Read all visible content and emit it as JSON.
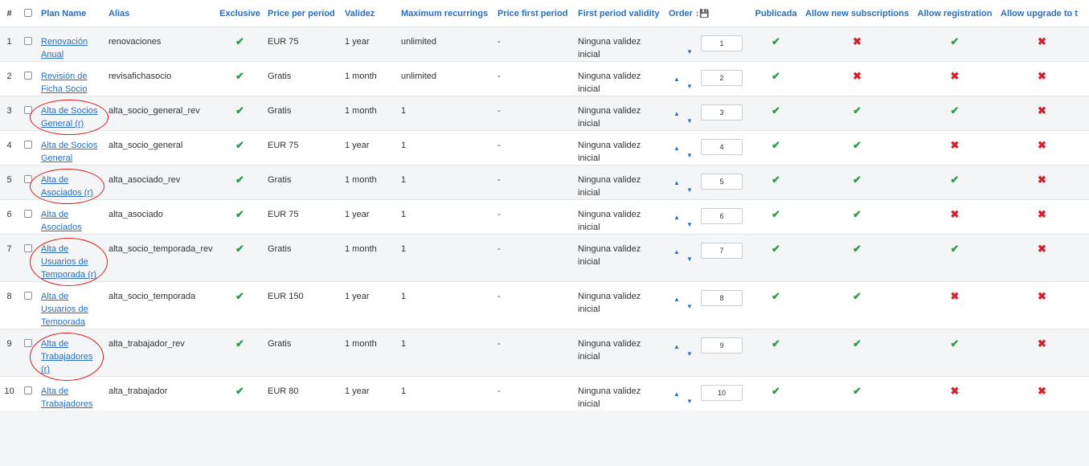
{
  "headers": {
    "num": "#",
    "plan_name": "Plan Name",
    "alias": "Alias",
    "exclusive": "Exclusive",
    "price": "Price per period",
    "validez": "Validez",
    "max_recurrings": "Maximum recurrings",
    "price_first": "Price first period",
    "first_validity": "First period validity",
    "order": "Order",
    "order_icons": "↕💾",
    "publicada": "Publicada",
    "allow_new": "Allow new subscriptions",
    "allow_reg": "Allow registration",
    "allow_upgrade": "Allow upgrade to t"
  },
  "icons": {
    "yes": "check-icon",
    "no": "cross-icon",
    "sort": "sort-icon",
    "save": "save-icon"
  },
  "colors": {
    "link": "#2a6ebd",
    "check": "#2e9a4a",
    "cross": "#d3212d",
    "annotation": "#d81c1c"
  },
  "rows": [
    {
      "num": "1",
      "name": "Renovación Anual",
      "alias": "renovaciones",
      "exclusive": true,
      "price": "EUR 75",
      "validez": "1 year",
      "max": "unlimited",
      "price_first": "-",
      "first_validity": "Ninguna validez inicial",
      "order": "1",
      "published": true,
      "allow_new": false,
      "allow_reg": true,
      "allow_upgrade": false,
      "circled": false
    },
    {
      "num": "2",
      "name": "Revisión de Ficha Socio",
      "alias": "revisafichasocio",
      "exclusive": true,
      "price": "Gratis",
      "validez": "1 month",
      "max": "unlimited",
      "price_first": "-",
      "first_validity": "Ninguna validez inicial",
      "order": "2",
      "published": true,
      "allow_new": false,
      "allow_reg": false,
      "allow_upgrade": false,
      "circled": false
    },
    {
      "num": "3",
      "name": "Alta de Socios General (r)",
      "alias": "alta_socio_general_rev",
      "exclusive": true,
      "price": "Gratis",
      "validez": "1 month",
      "max": "1",
      "price_first": "-",
      "first_validity": "Ninguna validez inicial",
      "order": "3",
      "published": true,
      "allow_new": true,
      "allow_reg": true,
      "allow_upgrade": false,
      "circled": true
    },
    {
      "num": "4",
      "name": "Alta de Socios General",
      "alias": "alta_socio_general",
      "exclusive": true,
      "price": "EUR 75",
      "validez": "1 year",
      "max": "1",
      "price_first": "-",
      "first_validity": "Ninguna validez inicial",
      "order": "4",
      "published": true,
      "allow_new": true,
      "allow_reg": false,
      "allow_upgrade": false,
      "circled": false
    },
    {
      "num": "5",
      "name": "Alta de Asociados (r)",
      "alias": "alta_asociado_rev",
      "exclusive": true,
      "price": "Gratis",
      "validez": "1 month",
      "max": "1",
      "price_first": "-",
      "first_validity": "Ninguna validez inicial",
      "order": "5",
      "published": true,
      "allow_new": true,
      "allow_reg": true,
      "allow_upgrade": false,
      "circled": true
    },
    {
      "num": "6",
      "name": "Alta de Asociados",
      "alias": "alta_asociado",
      "exclusive": true,
      "price": "EUR 75",
      "validez": "1 year",
      "max": "1",
      "price_first": "-",
      "first_validity": "Ninguna validez inicial",
      "order": "6",
      "published": true,
      "allow_new": true,
      "allow_reg": false,
      "allow_upgrade": false,
      "circled": false
    },
    {
      "num": "7",
      "name": "Alta de Usuarios de Temporada (r)",
      "alias": "alta_socio_temporada_rev",
      "exclusive": true,
      "price": "Gratis",
      "validez": "1 month",
      "max": "1",
      "price_first": "-",
      "first_validity": "Ninguna validez inicial",
      "order": "7",
      "published": true,
      "allow_new": true,
      "allow_reg": true,
      "allow_upgrade": false,
      "circled": true
    },
    {
      "num": "8",
      "name": "Alta de Usuarios de Temporada",
      "alias": "alta_socio_temporada",
      "exclusive": true,
      "price": "EUR 150",
      "validez": "1 year",
      "max": "1",
      "price_first": "-",
      "first_validity": "Ninguna validez inicial",
      "order": "8",
      "published": true,
      "allow_new": true,
      "allow_reg": false,
      "allow_upgrade": false,
      "circled": false
    },
    {
      "num": "9",
      "name": "Alta de Trabajadores (r)",
      "alias": "alta_trabajador_rev",
      "exclusive": true,
      "price": "Gratis",
      "validez": "1 month",
      "max": "1",
      "price_first": "-",
      "first_validity": "Ninguna validez inicial",
      "order": "9",
      "published": true,
      "allow_new": true,
      "allow_reg": true,
      "allow_upgrade": false,
      "circled": true
    },
    {
      "num": "10",
      "name": "Alta de Trabajadores",
      "alias": "alta_trabajador",
      "exclusive": true,
      "price": "EUR 80",
      "validez": "1 year",
      "max": "1",
      "price_first": "-",
      "first_validity": "Ninguna validez inicial",
      "order": "10",
      "published": true,
      "allow_new": true,
      "allow_reg": false,
      "allow_upgrade": false,
      "circled": false
    }
  ]
}
